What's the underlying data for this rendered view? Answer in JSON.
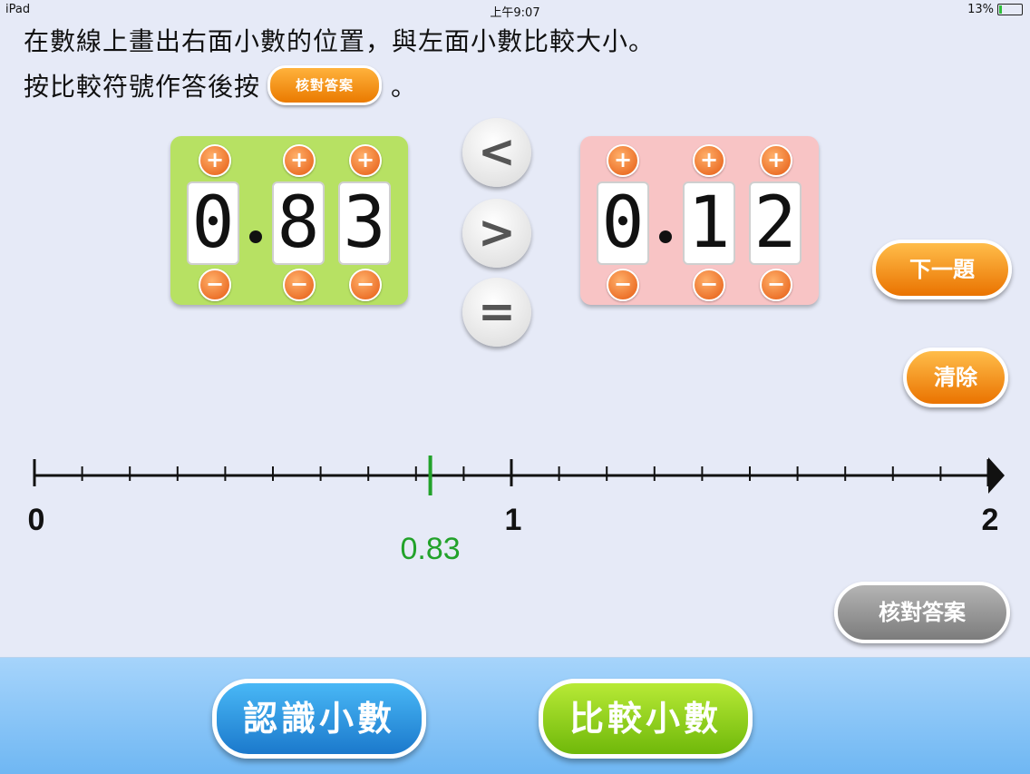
{
  "status_bar": {
    "device": "iPad",
    "time": "上午9:07",
    "battery": "13%",
    "battery_level": 0.13
  },
  "instructions": {
    "line1": "在數線上畫出右面小數的位置，與左面小數比較大小。",
    "line2_prefix": "按比較符號作答後按",
    "line2_button": "核對答案",
    "line2_suffix": "。"
  },
  "left_number": {
    "digits": [
      "0",
      "8",
      "3"
    ],
    "plus_symbol": "+",
    "minus_symbol": "−"
  },
  "right_number": {
    "digits": [
      "0",
      "1",
      "2"
    ],
    "plus_symbol": "+",
    "minus_symbol": "−"
  },
  "comparators": {
    "less": "<",
    "greater": ">",
    "equal": "="
  },
  "buttons": {
    "next": "下一題",
    "clear": "清除",
    "check": "核對答案"
  },
  "number_line": {
    "labels": [
      "0",
      "1",
      "2"
    ],
    "marker_value": 0.83,
    "marker_label": "0.83",
    "marker_color": "#22a22a"
  },
  "bottom_tabs": {
    "learn": "認識小數",
    "compare": "比較小數"
  }
}
